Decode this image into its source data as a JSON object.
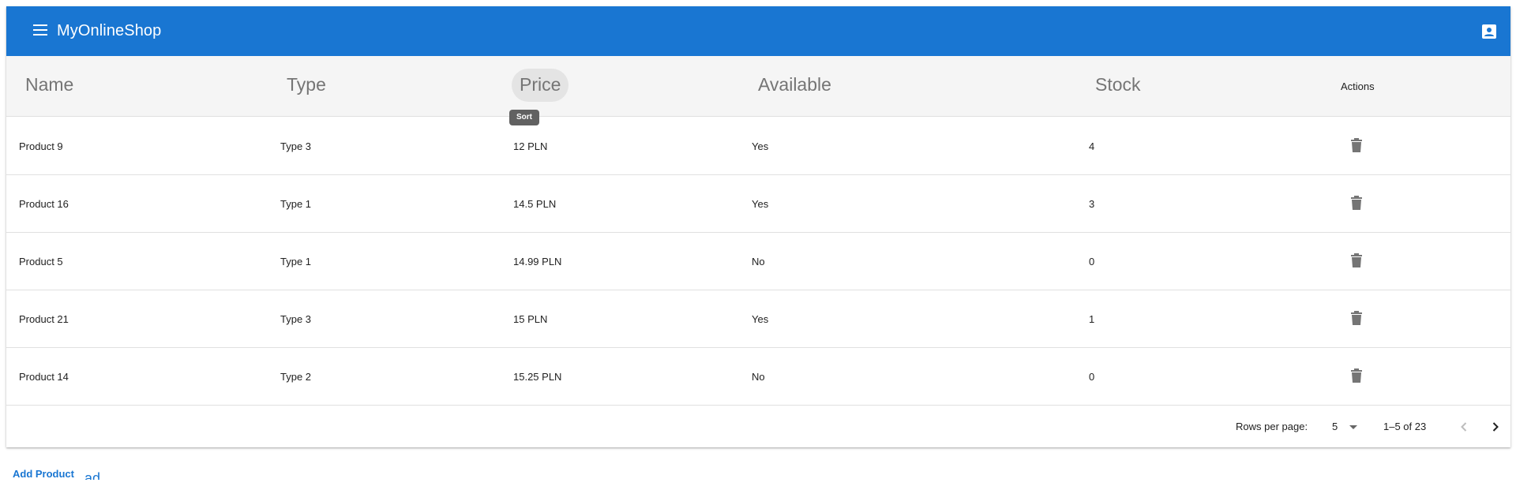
{
  "app": {
    "title": "MyOnlineShop"
  },
  "table": {
    "headers": {
      "name": "Name",
      "type": "Type",
      "price": "Price",
      "available": "Available",
      "stock": "Stock",
      "actions": "Actions"
    },
    "sort_tooltip": "Sort",
    "rows": [
      {
        "name": "Product 9",
        "type": "Type 3",
        "price": "12 PLN",
        "available": "Yes",
        "stock": "4"
      },
      {
        "name": "Product 16",
        "type": "Type 1",
        "price": "14.5 PLN",
        "available": "Yes",
        "stock": "3"
      },
      {
        "name": "Product 5",
        "type": "Type 1",
        "price": "14.99 PLN",
        "available": "No",
        "stock": "0"
      },
      {
        "name": "Product 21",
        "type": "Type 3",
        "price": "15 PLN",
        "available": "Yes",
        "stock": "1"
      },
      {
        "name": "Product 14",
        "type": "Type 2",
        "price": "15.25 PLN",
        "available": "No",
        "stock": "0"
      }
    ]
  },
  "pagination": {
    "rows_per_page_label": "Rows per page:",
    "rows_per_page_value": "5",
    "range": "1–5 of 23"
  },
  "actions": {
    "add_product": "Add Product",
    "ghost_text": "ad"
  },
  "colors": {
    "primary": "#1976d2",
    "header_bg": "#f5f5f5",
    "tooltip_bg": "#616161",
    "icon": "#757575"
  }
}
